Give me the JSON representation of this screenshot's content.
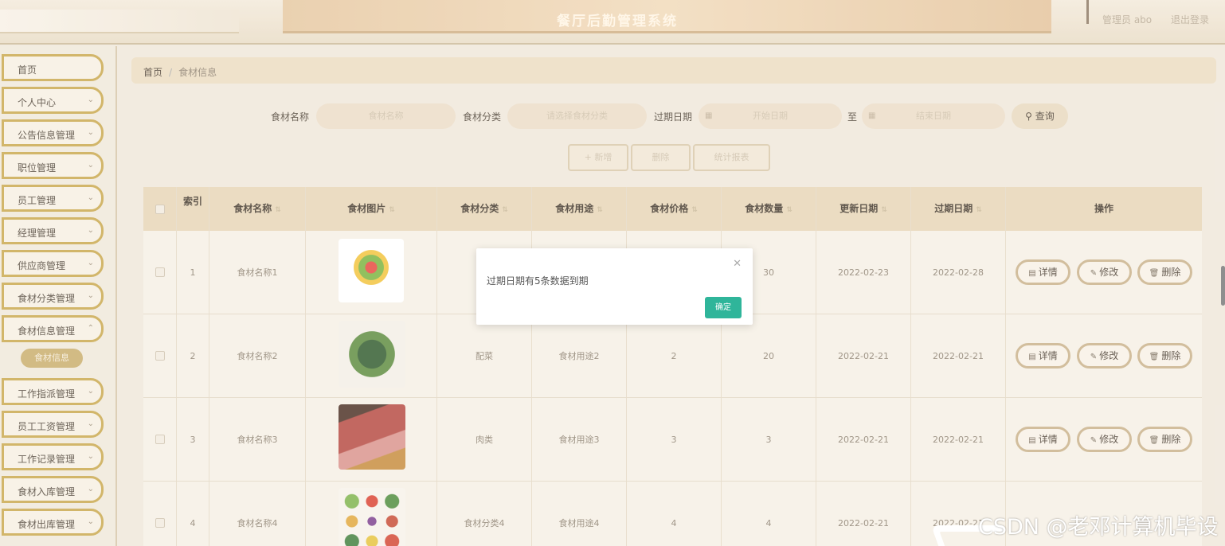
{
  "header": {
    "title": "餐厅后勤管理系统",
    "user": "管理员 abo",
    "logout": "退出登录"
  },
  "sidebar": {
    "items": [
      {
        "label": "首页"
      },
      {
        "label": "个人中心"
      },
      {
        "label": "公告信息管理"
      },
      {
        "label": "职位管理"
      },
      {
        "label": "员工管理"
      },
      {
        "label": "经理管理"
      },
      {
        "label": "供应商管理"
      },
      {
        "label": "食材分类管理"
      },
      {
        "label": "食材信息管理"
      },
      {
        "label": "工作指派管理"
      },
      {
        "label": "员工工资管理"
      },
      {
        "label": "工作记录管理"
      },
      {
        "label": "食材入库管理"
      },
      {
        "label": "食材出库管理"
      }
    ],
    "submenu_active": "食材信息"
  },
  "breadcrumb": {
    "home": "首页",
    "current": "食材信息"
  },
  "search": {
    "name_label": "食材名称",
    "name_placeholder": "食材名称",
    "category_label": "食材分类",
    "category_placeholder": "请选择食材分类",
    "expire_label": "过期日期",
    "start_placeholder": "开始日期",
    "to_label": "至",
    "end_placeholder": "结束日期",
    "query_button": "查询"
  },
  "actions": {
    "add": "+ 新增",
    "delete": "删除",
    "report": "统计报表"
  },
  "table": {
    "columns": [
      "索引",
      "食材名称",
      "食材图片",
      "食材分类",
      "食材用途",
      "食材价格",
      "食材数量",
      "更新日期",
      "过期日期",
      "操作"
    ],
    "rows": [
      {
        "index": "1",
        "name": "食材名称1",
        "category": "",
        "usage": "",
        "price": "",
        "qty": "30",
        "updated": "2022-02-23",
        "expire": "2022-02-28"
      },
      {
        "index": "2",
        "name": "食材名称2",
        "category": "配菜",
        "usage": "食材用途2",
        "price": "2",
        "qty": "20",
        "updated": "2022-02-21",
        "expire": "2022-02-21"
      },
      {
        "index": "3",
        "name": "食材名称3",
        "category": "肉类",
        "usage": "食材用途3",
        "price": "3",
        "qty": "3",
        "updated": "2022-02-21",
        "expire": "2022-02-21"
      },
      {
        "index": "4",
        "name": "食材名称4",
        "category": "食材分类4",
        "usage": "食材用途4",
        "price": "4",
        "qty": "4",
        "updated": "2022-02-21",
        "expire": "2022-02-21"
      }
    ],
    "op_detail": "详情",
    "op_edit": "修改",
    "op_delete": "删除"
  },
  "dialog": {
    "message": "过期日期有5条数据到期",
    "ok": "确定"
  },
  "watermark": "CSDN @老邓计算机毕设"
}
